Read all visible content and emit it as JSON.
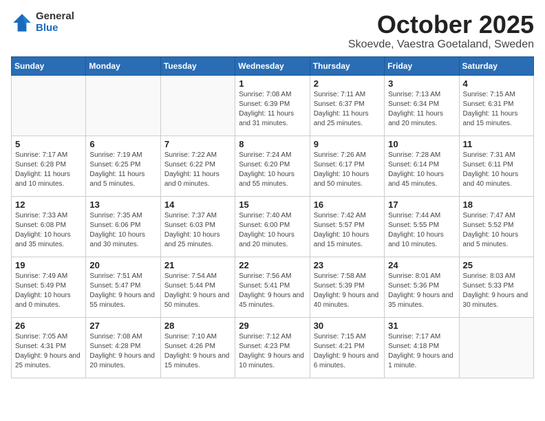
{
  "header": {
    "logo_general": "General",
    "logo_blue": "Blue",
    "month_title": "October 2025",
    "location": "Skoevde, Vaestra Goetaland, Sweden"
  },
  "weekdays": [
    "Sunday",
    "Monday",
    "Tuesday",
    "Wednesday",
    "Thursday",
    "Friday",
    "Saturday"
  ],
  "weeks": [
    [
      {
        "day": "",
        "info": ""
      },
      {
        "day": "",
        "info": ""
      },
      {
        "day": "",
        "info": ""
      },
      {
        "day": "1",
        "info": "Sunrise: 7:08 AM\nSunset: 6:39 PM\nDaylight: 11 hours\nand 31 minutes."
      },
      {
        "day": "2",
        "info": "Sunrise: 7:11 AM\nSunset: 6:37 PM\nDaylight: 11 hours\nand 25 minutes."
      },
      {
        "day": "3",
        "info": "Sunrise: 7:13 AM\nSunset: 6:34 PM\nDaylight: 11 hours\nand 20 minutes."
      },
      {
        "day": "4",
        "info": "Sunrise: 7:15 AM\nSunset: 6:31 PM\nDaylight: 11 hours\nand 15 minutes."
      }
    ],
    [
      {
        "day": "5",
        "info": "Sunrise: 7:17 AM\nSunset: 6:28 PM\nDaylight: 11 hours\nand 10 minutes."
      },
      {
        "day": "6",
        "info": "Sunrise: 7:19 AM\nSunset: 6:25 PM\nDaylight: 11 hours\nand 5 minutes."
      },
      {
        "day": "7",
        "info": "Sunrise: 7:22 AM\nSunset: 6:22 PM\nDaylight: 11 hours\nand 0 minutes."
      },
      {
        "day": "8",
        "info": "Sunrise: 7:24 AM\nSunset: 6:20 PM\nDaylight: 10 hours\nand 55 minutes."
      },
      {
        "day": "9",
        "info": "Sunrise: 7:26 AM\nSunset: 6:17 PM\nDaylight: 10 hours\nand 50 minutes."
      },
      {
        "day": "10",
        "info": "Sunrise: 7:28 AM\nSunset: 6:14 PM\nDaylight: 10 hours\nand 45 minutes."
      },
      {
        "day": "11",
        "info": "Sunrise: 7:31 AM\nSunset: 6:11 PM\nDaylight: 10 hours\nand 40 minutes."
      }
    ],
    [
      {
        "day": "12",
        "info": "Sunrise: 7:33 AM\nSunset: 6:08 PM\nDaylight: 10 hours\nand 35 minutes."
      },
      {
        "day": "13",
        "info": "Sunrise: 7:35 AM\nSunset: 6:06 PM\nDaylight: 10 hours\nand 30 minutes."
      },
      {
        "day": "14",
        "info": "Sunrise: 7:37 AM\nSunset: 6:03 PM\nDaylight: 10 hours\nand 25 minutes."
      },
      {
        "day": "15",
        "info": "Sunrise: 7:40 AM\nSunset: 6:00 PM\nDaylight: 10 hours\nand 20 minutes."
      },
      {
        "day": "16",
        "info": "Sunrise: 7:42 AM\nSunset: 5:57 PM\nDaylight: 10 hours\nand 15 minutes."
      },
      {
        "day": "17",
        "info": "Sunrise: 7:44 AM\nSunset: 5:55 PM\nDaylight: 10 hours\nand 10 minutes."
      },
      {
        "day": "18",
        "info": "Sunrise: 7:47 AM\nSunset: 5:52 PM\nDaylight: 10 hours\nand 5 minutes."
      }
    ],
    [
      {
        "day": "19",
        "info": "Sunrise: 7:49 AM\nSunset: 5:49 PM\nDaylight: 10 hours\nand 0 minutes."
      },
      {
        "day": "20",
        "info": "Sunrise: 7:51 AM\nSunset: 5:47 PM\nDaylight: 9 hours\nand 55 minutes."
      },
      {
        "day": "21",
        "info": "Sunrise: 7:54 AM\nSunset: 5:44 PM\nDaylight: 9 hours\nand 50 minutes."
      },
      {
        "day": "22",
        "info": "Sunrise: 7:56 AM\nSunset: 5:41 PM\nDaylight: 9 hours\nand 45 minutes."
      },
      {
        "day": "23",
        "info": "Sunrise: 7:58 AM\nSunset: 5:39 PM\nDaylight: 9 hours\nand 40 minutes."
      },
      {
        "day": "24",
        "info": "Sunrise: 8:01 AM\nSunset: 5:36 PM\nDaylight: 9 hours\nand 35 minutes."
      },
      {
        "day": "25",
        "info": "Sunrise: 8:03 AM\nSunset: 5:33 PM\nDaylight: 9 hours\nand 30 minutes."
      }
    ],
    [
      {
        "day": "26",
        "info": "Sunrise: 7:05 AM\nSunset: 4:31 PM\nDaylight: 9 hours\nand 25 minutes."
      },
      {
        "day": "27",
        "info": "Sunrise: 7:08 AM\nSunset: 4:28 PM\nDaylight: 9 hours\nand 20 minutes."
      },
      {
        "day": "28",
        "info": "Sunrise: 7:10 AM\nSunset: 4:26 PM\nDaylight: 9 hours\nand 15 minutes."
      },
      {
        "day": "29",
        "info": "Sunrise: 7:12 AM\nSunset: 4:23 PM\nDaylight: 9 hours\nand 10 minutes."
      },
      {
        "day": "30",
        "info": "Sunrise: 7:15 AM\nSunset: 4:21 PM\nDaylight: 9 hours\nand 6 minutes."
      },
      {
        "day": "31",
        "info": "Sunrise: 7:17 AM\nSunset: 4:18 PM\nDaylight: 9 hours\nand 1 minute."
      },
      {
        "day": "",
        "info": ""
      }
    ]
  ]
}
